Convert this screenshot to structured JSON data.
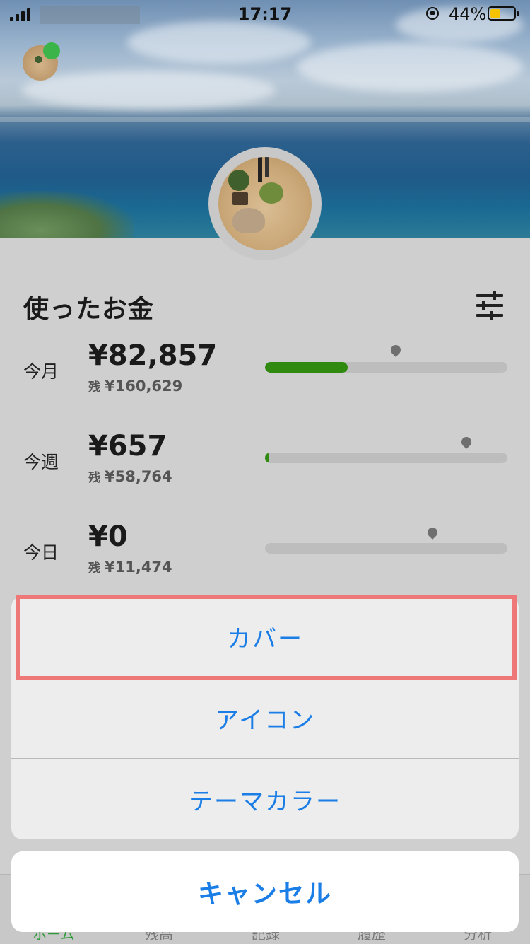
{
  "status_bar": {
    "time": "17:17",
    "battery_percent_label": "44%",
    "battery_level": 0.44,
    "battery_color": "#f5c300",
    "signal_icon": "cellular-signal-icon",
    "rotation_lock_icon": "rotation-lock-icon"
  },
  "profile": {
    "online_status_color": "#3bb54a"
  },
  "spending": {
    "title": "使ったお金",
    "filter_icon": "sliders-icon",
    "rows": [
      {
        "label": "今月",
        "amount": "¥82,857",
        "remain_prefix": "残",
        "remain": "¥160,629",
        "progress": 0.34,
        "marker": 0.54
      },
      {
        "label": "今週",
        "amount": "¥657",
        "remain_prefix": "残",
        "remain": "¥58,764",
        "progress": 0.01,
        "marker": 0.83
      },
      {
        "label": "今日",
        "amount": "¥0",
        "remain_prefix": "残",
        "remain": "¥11,474",
        "progress": 0.0,
        "marker": 0.69
      }
    ],
    "progress_color": "#2f8a0f"
  },
  "action_sheet": {
    "items": [
      "カバー",
      "アイコン",
      "テーマカラー"
    ],
    "cancel": "キャンセル",
    "highlighted_item": "カバー",
    "text_color": "#1a7ee6"
  },
  "tab_bar": {
    "tabs": [
      "ホーム",
      "残高",
      "記録",
      "履歴",
      "分析"
    ],
    "active": "ホーム",
    "active_color": "#2f9a3a"
  }
}
